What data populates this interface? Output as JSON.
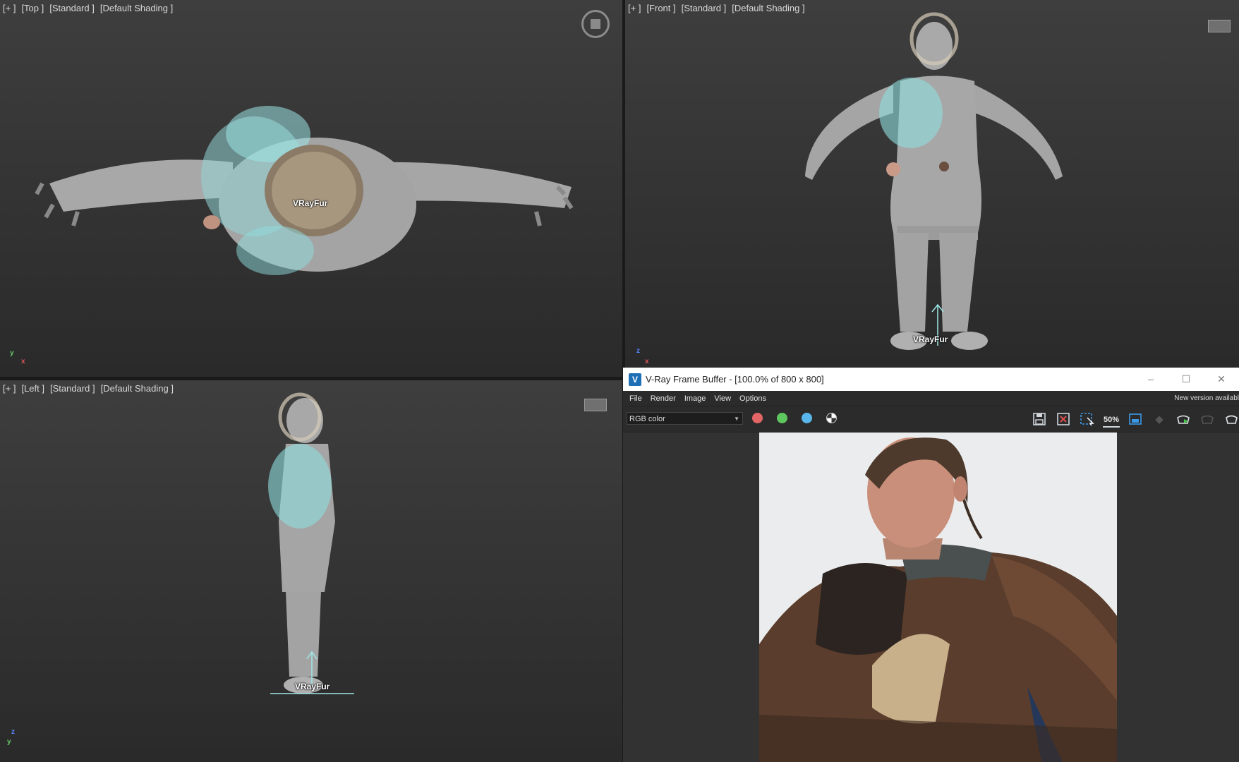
{
  "viewports": {
    "top": {
      "plus": "[+ ]",
      "view": "[Top ]",
      "style": "[Standard ]",
      "shading": "[Default Shading ]",
      "fur_label": "VRayFur"
    },
    "front": {
      "plus": "[+ ]",
      "view": "[Front ]",
      "style": "[Standard ]",
      "shading": "[Default Shading ]",
      "fur_label": "VRayFur"
    },
    "left": {
      "plus": "[+ ]",
      "view": "[Left ]",
      "style": "[Standard ]",
      "shading": "[Default Shading ]",
      "fur_label": "VRayFur"
    },
    "axis_top": {
      "a": "y",
      "b": "x"
    },
    "axis_front": {
      "a": "z",
      "b": "x"
    },
    "axis_left": {
      "a": "z",
      "b": "y"
    }
  },
  "vfb": {
    "title": "V-Ray Frame Buffer - [100.0% of 800 x 800]",
    "menu": [
      "File",
      "Render",
      "Image",
      "View",
      "Options"
    ],
    "new_version": "New version availabl",
    "channel": "RGB color",
    "channel_colors": {
      "red": "#e46565",
      "green": "#5ec65e",
      "blue": "#59b6ea"
    },
    "zoom_label": "50%",
    "window_buttons": [
      "–",
      "☐",
      "✕"
    ]
  },
  "icons": [
    "viewcube-icon",
    "save-icon",
    "clear-icon",
    "region-icon",
    "zoom-icon",
    "lens-icon",
    "history-icon",
    "render-teapot-icon",
    "interactive-teapot-icon"
  ],
  "colors": {
    "fur": "#8fe2e2",
    "mesh": "#a9a9a9",
    "vray_blue": "#1f6fb5"
  }
}
